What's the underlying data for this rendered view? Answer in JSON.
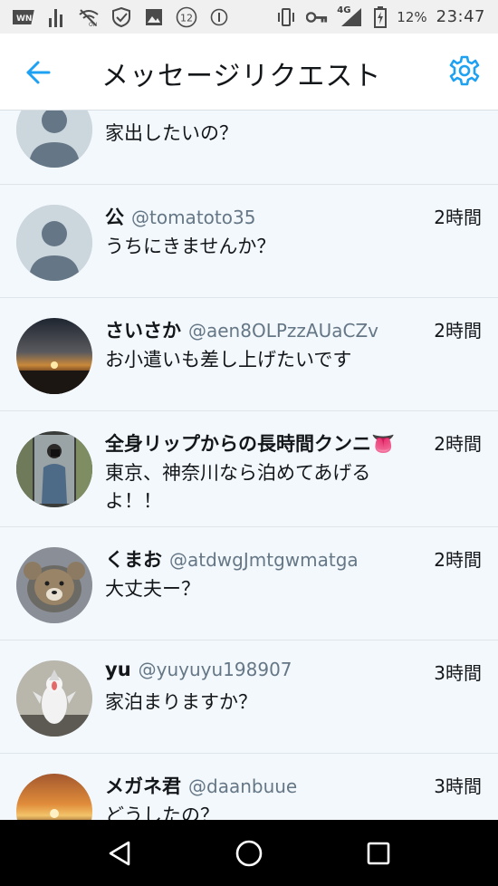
{
  "status_bar": {
    "network_type": "4G",
    "battery_percent": "12%",
    "time": "23:47",
    "notification_count": "12",
    "icons": [
      "wnn-icon",
      "signal-bars-icon",
      "wifi-off-icon",
      "vpn-shield-icon",
      "image-icon",
      "notification-count-icon",
      "info-icon",
      "vibrate-icon",
      "key-icon",
      "cell-signal-icon",
      "battery-icon"
    ]
  },
  "header": {
    "title": "メッセージリクエスト",
    "back_icon": "arrow-left-icon",
    "settings_icon": "gear-icon"
  },
  "colors": {
    "accent": "#1da1f2",
    "background": "#f3f8fc",
    "text_primary": "#14171a",
    "text_secondary": "#657786"
  },
  "requests": [
    {
      "name": "",
      "handle": "",
      "time": "",
      "message": "家出したいの？"
    },
    {
      "name": "公",
      "handle": "@tomatoto35",
      "time": "2時間",
      "message": "うちにきませんか？"
    },
    {
      "name": "さいさか",
      "handle": "@aen8OLPzzAUaCZv",
      "time": "2時間",
      "message": "お小遣いも差し上げたいです"
    },
    {
      "name": "全身リップからの長時間クンニ👅",
      "handle": "",
      "time": "2時間",
      "message": "東京、神奈川なら泊めてあげるよ！！"
    },
    {
      "name": "くまお",
      "handle": "@atdwgJmtgwmatga",
      "time": "2時間",
      "message": "大丈夫ー？"
    },
    {
      "name": "yu",
      "handle": "@yuyuyu198907",
      "time": "3時間",
      "message": "家泊まりますか？"
    },
    {
      "name": "メガネ君",
      "handle": "@daanbuue",
      "time": "3時間",
      "message": "どうしたの？"
    }
  ],
  "nav": {
    "back_icon": "triangle-back-icon",
    "home_icon": "circle-home-icon",
    "recents_icon": "square-recents-icon"
  }
}
